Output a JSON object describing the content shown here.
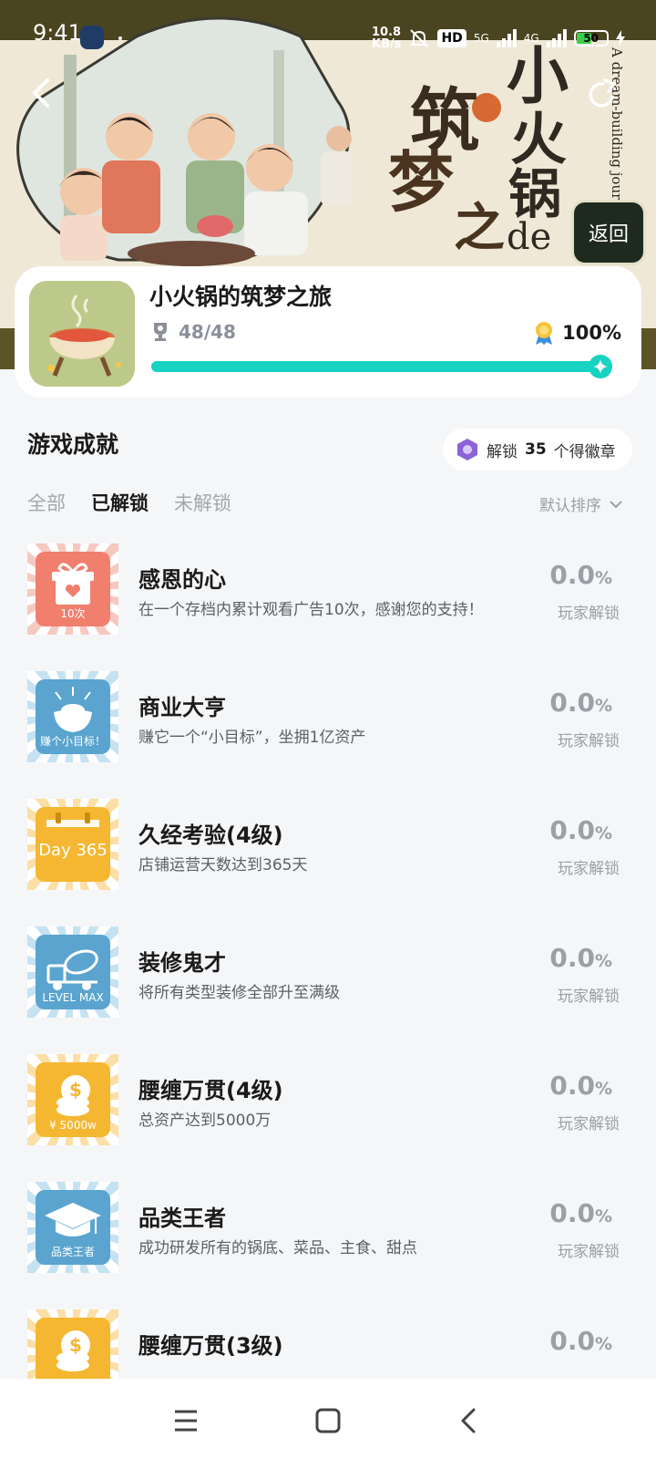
{
  "status_bar": {
    "time": "9:41",
    "net_speed_value": "10.8",
    "net_speed_unit": "KB/s",
    "hd_label": "HD",
    "sig1_label": "5G",
    "sig2_label": "4G",
    "battery_level": "50",
    "battery_fraction": 0.5
  },
  "header": {
    "hero_title_chars": [
      "小",
      "火",
      "锅",
      "de",
      "筑",
      "梦",
      "之"
    ],
    "hero_subtitle": "A dream-building journey of mini hotpot",
    "return_label": "返回"
  },
  "game": {
    "name": "小火锅的筑梦之旅",
    "trophies": "48/48",
    "completion": "100%",
    "progress_fraction": 1.0
  },
  "section": {
    "title": "游戏成就",
    "badge_prefix": "解锁",
    "badge_count": "35",
    "badge_suffix": "个得徽章"
  },
  "filters": {
    "tabs": [
      "全部",
      "已解锁",
      "未解锁"
    ],
    "active_index": 1,
    "sort_label": "默认排序"
  },
  "achievements": [
    {
      "title": "感恩的心",
      "desc": "在一个存档内累计观看广告10次，感谢您的支持！",
      "pct": "0.0",
      "unit": "%",
      "label": "玩家解锁",
      "icon": "gift-icon",
      "caption": "10次",
      "color": "#f07f6e",
      "ray": "#f6c9c0"
    },
    {
      "title": "商业大亨",
      "desc": "赚它一个“小目标”，坐拥1亿资产",
      "pct": "0.0",
      "unit": "%",
      "label": "玩家解锁",
      "icon": "gold-ingot-icon",
      "caption": "赚个小目标！",
      "color": "#5aa4cf",
      "ray": "#c5e2f2"
    },
    {
      "title": "久经考验(4级)",
      "desc": "店铺运营天数达到365天",
      "pct": "0.0",
      "unit": "%",
      "label": "玩家解锁",
      "icon": "calendar-icon",
      "caption": "Day 365",
      "color": "#f5b732",
      "ray": "#fbdfa6"
    },
    {
      "title": "装修鬼才",
      "desc": "将所有类型装修全部升至满级",
      "pct": "0.0",
      "unit": "%",
      "label": "玩家解锁",
      "icon": "cement-truck-icon",
      "caption": "LEVEL MAX",
      "color": "#5aa4cf",
      "ray": "#c5e2f2"
    },
    {
      "title": "腰缠万贯(4级)",
      "desc": "总资产达到5000万",
      "pct": "0.0",
      "unit": "%",
      "label": "玩家解锁",
      "icon": "coin-stack-icon",
      "caption": "¥ 5000w",
      "color": "#f5b732",
      "ray": "#fbdfa6"
    },
    {
      "title": "品类王者",
      "desc": "成功研发所有的锅底、菜品、主食、甜点",
      "pct": "0.0",
      "unit": "%",
      "label": "玩家解锁",
      "icon": "graduation-cap-icon",
      "caption": "品类王者",
      "color": "#5aa4cf",
      "ray": "#c5e2f2"
    },
    {
      "title": "腰缠万贯(3级)",
      "desc": "",
      "pct": "0.0",
      "unit": "%",
      "label": "",
      "icon": "coin-stack-icon",
      "caption": "",
      "color": "#f5b732",
      "ray": "#fbdfa6"
    }
  ]
}
